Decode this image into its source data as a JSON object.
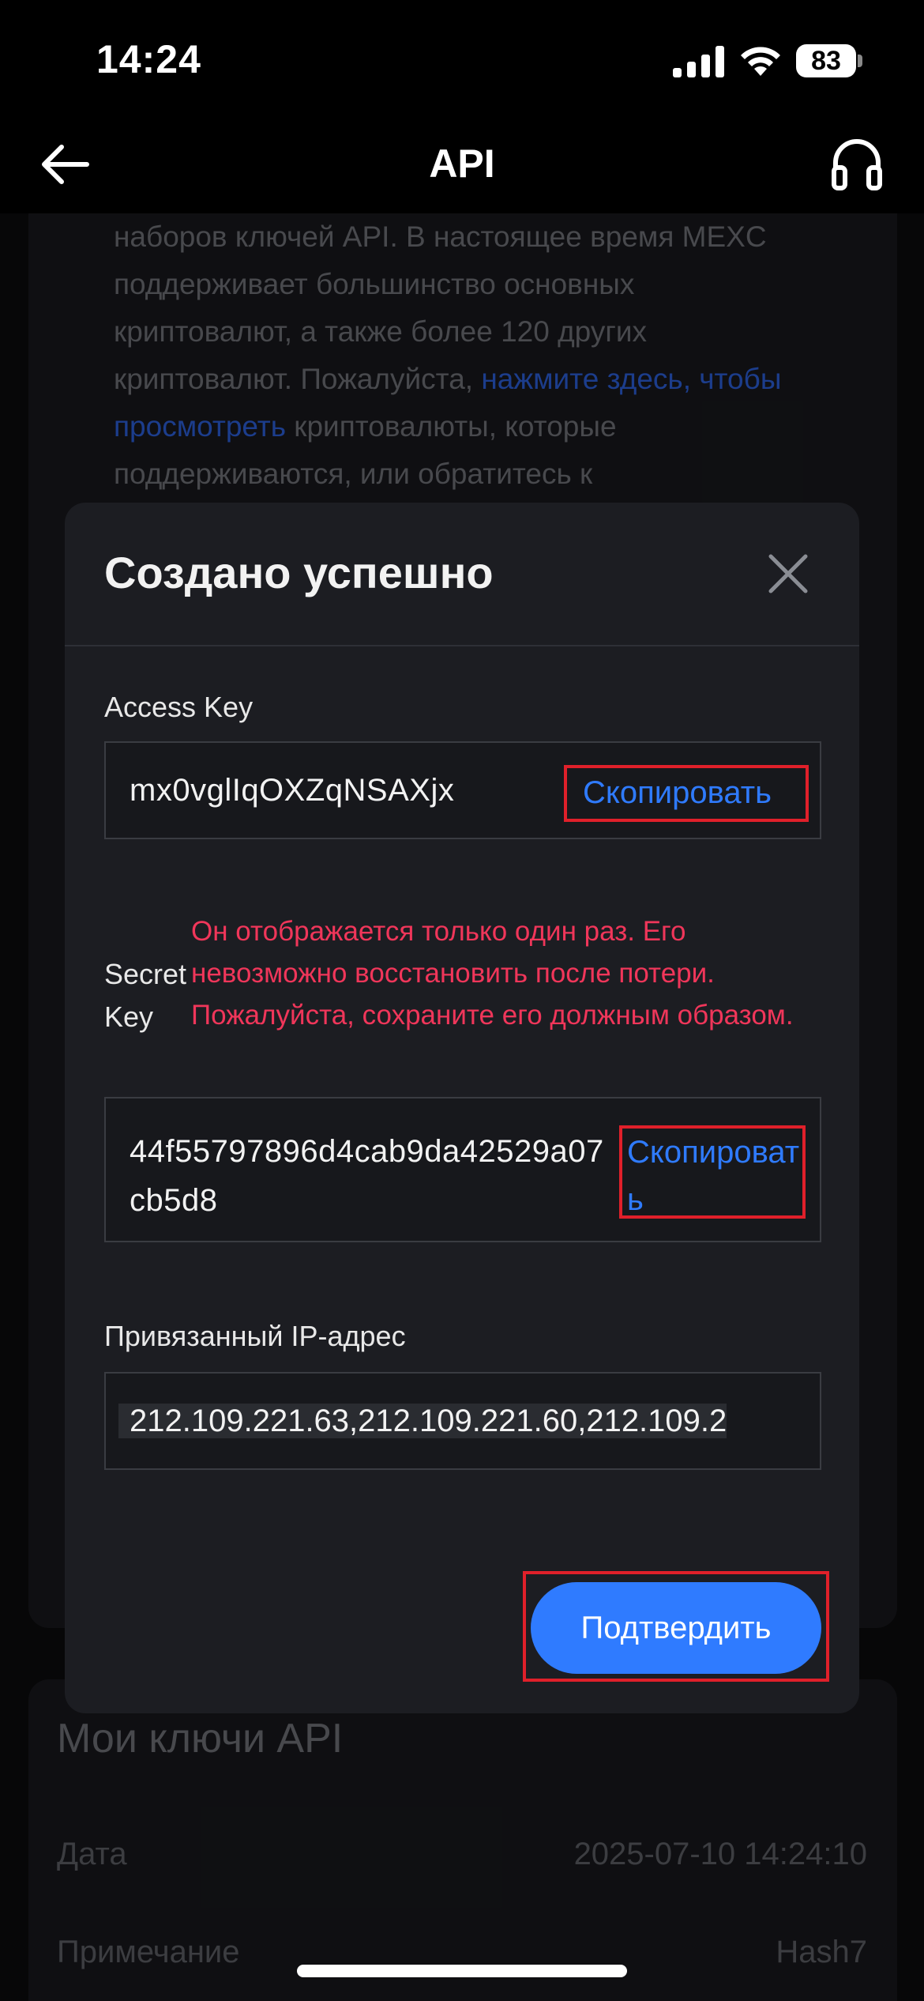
{
  "status_bar": {
    "time": "14:24",
    "battery": "83"
  },
  "nav": {
    "title": "API"
  },
  "background": {
    "paragraph_parts": [
      "наборов ключей API. В настоящее время MEXC поддерживает большинство основных криптовалют, а также более 120 других криптовалют. Пожалуйста, ",
      "нажмите здесь, чтобы просмотреть",
      " криптовалюты, которые поддерживаются, или обратитесь к"
    ],
    "keys_title": "Мои ключи API",
    "rows": [
      {
        "label": "Дата",
        "value": "2025-07-10 14:24:10"
      },
      {
        "label": "Примечание",
        "value": "Hash7"
      }
    ]
  },
  "modal": {
    "title": "Создано успешно",
    "access_key": {
      "label": "Access Key",
      "value": "mx0vglIqOXZqNSAXjx",
      "copy_label": "Скопировать"
    },
    "secret_key": {
      "label": "Secret Key",
      "warning": "Он отображается только один раз. Его невозможно восстановить после потери. Пожалуйста, сохраните его должным образом.",
      "value": "44f55797896d4cab9da42529a07cb5d8",
      "copy_label": "Скопировать"
    },
    "ip": {
      "label": "Привязанный IP-адрес",
      "value": "212.109.221.63,212.109.221.60,212.109.2"
    },
    "confirm_label": "Подтвердить"
  },
  "colors": {
    "accent": "#2f7bff",
    "warning": "#f0365a",
    "highlight": "#e0202a",
    "modal_bg": "#1c1d22"
  }
}
